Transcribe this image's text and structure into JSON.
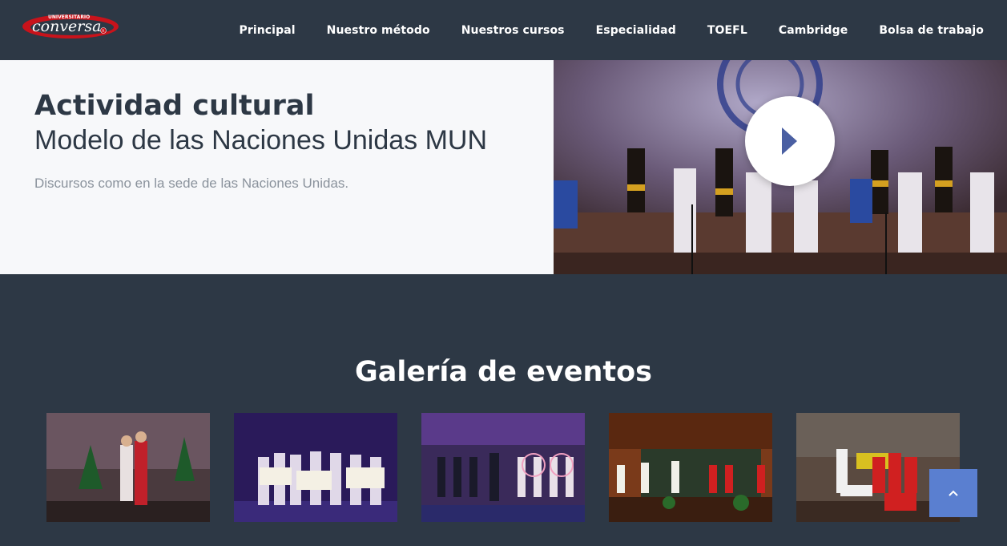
{
  "brand": {
    "logo_top": "UNIVERSITARIO",
    "logo_name": "conversa",
    "logo_mark": "R",
    "colors": {
      "logo_red": "#c8131b",
      "nav_bg": "#2d3845",
      "accent": "#5a7fd0"
    }
  },
  "nav": {
    "items": [
      "Principal",
      "Nuestro método",
      "Nuestros cursos",
      "Especialidad",
      "TOEFL",
      "Cambridge",
      "Bolsa de trabajo"
    ]
  },
  "hero": {
    "title": "Actividad cultural",
    "subtitle": "Modelo de las Naciones Unidas MUN",
    "text": "Discursos como en la sede de las Naciones Unidas.",
    "play_icon": "play-icon"
  },
  "gallery": {
    "title": "Galería de eventos",
    "thumb_count": 5
  },
  "scroll_top": {
    "icon": "chevron-up-icon"
  }
}
